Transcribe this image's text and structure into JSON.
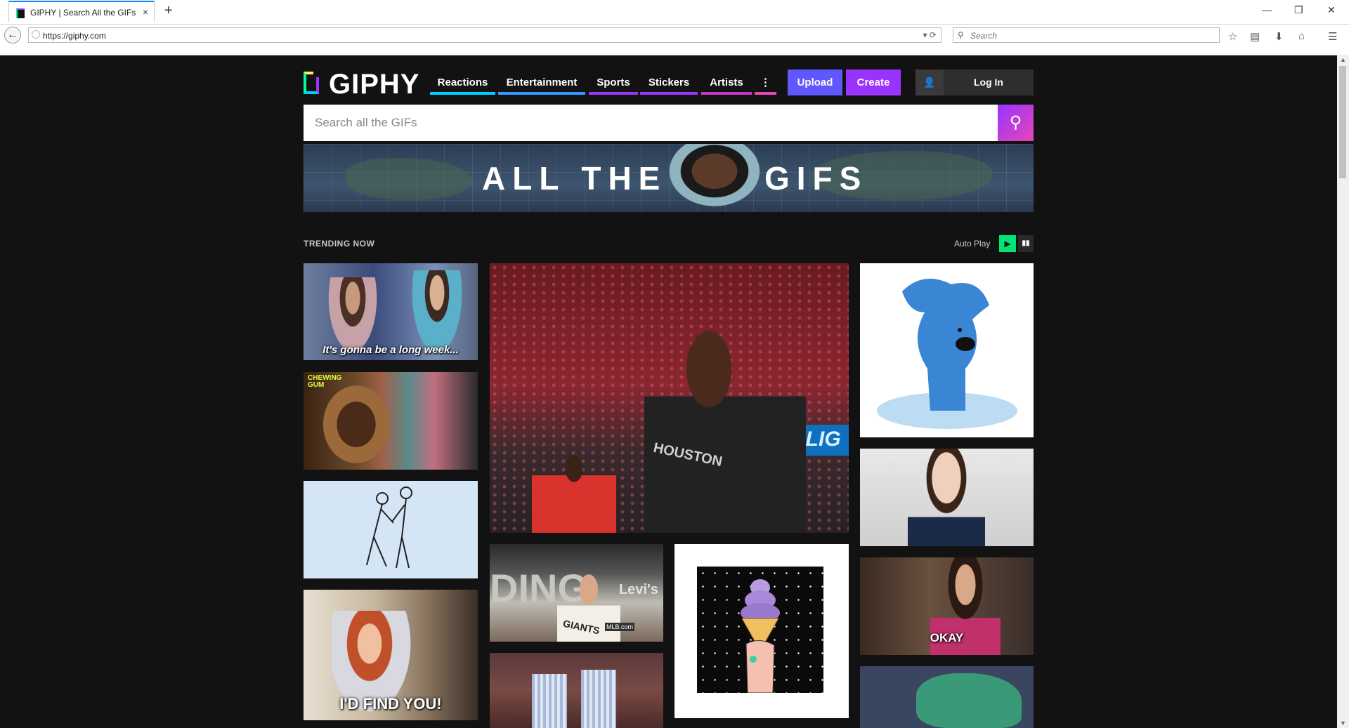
{
  "browser": {
    "tab_title": "GIPHY | Search All the GIFs ...",
    "tab_close": "×",
    "new_tab": "+",
    "url": "https://giphy.com",
    "search_placeholder": "Search",
    "window_controls": {
      "minimize": "—",
      "restore": "❐",
      "close": "✕"
    }
  },
  "header": {
    "logo_text": "GIPHY",
    "menu": [
      {
        "label": "Reactions",
        "color": "#00ccff"
      },
      {
        "label": "Entertainment",
        "color": "#3399ff"
      },
      {
        "label": "Sports",
        "color": "#9933ff"
      },
      {
        "label": "Stickers",
        "color": "#9933ff"
      },
      {
        "label": "Artists",
        "color": "#cc33cc"
      },
      {
        "label": "⋮",
        "color": "#e646b6"
      }
    ],
    "upload_label": "Upload",
    "create_label": "Create",
    "login_label": "Log In",
    "colors": {
      "upload": "#6157ff",
      "create": "#9933ff"
    }
  },
  "search": {
    "placeholder": "Search all the GIFs"
  },
  "banner": {
    "text_left": "ALL THE",
    "text_right": "GIFS"
  },
  "trending": {
    "label": "TRENDING NOW",
    "autoplay_label": "Auto Play",
    "play_icon": "▶",
    "pause_icon": "▮▮"
  },
  "gifs": {
    "col1": [
      {
        "caption": "It's gonna be a long week..."
      },
      {
        "caption": "CHEWING GUM"
      },
      {
        "caption": ""
      },
      {
        "caption": "I'D FIND YOU!"
      }
    ],
    "col3": [
      {
        "caption": ""
      },
      {
        "caption": ""
      },
      {
        "caption": "OKAY"
      },
      {
        "caption": ""
      }
    ],
    "center_large": {
      "jersey_text": "HOUSTON",
      "board_text": "UD LIG"
    },
    "center_small_left": {
      "text": "DING",
      "sign": "Levi's",
      "jersey": "GIANTS",
      "badge": "MLB.com"
    }
  }
}
